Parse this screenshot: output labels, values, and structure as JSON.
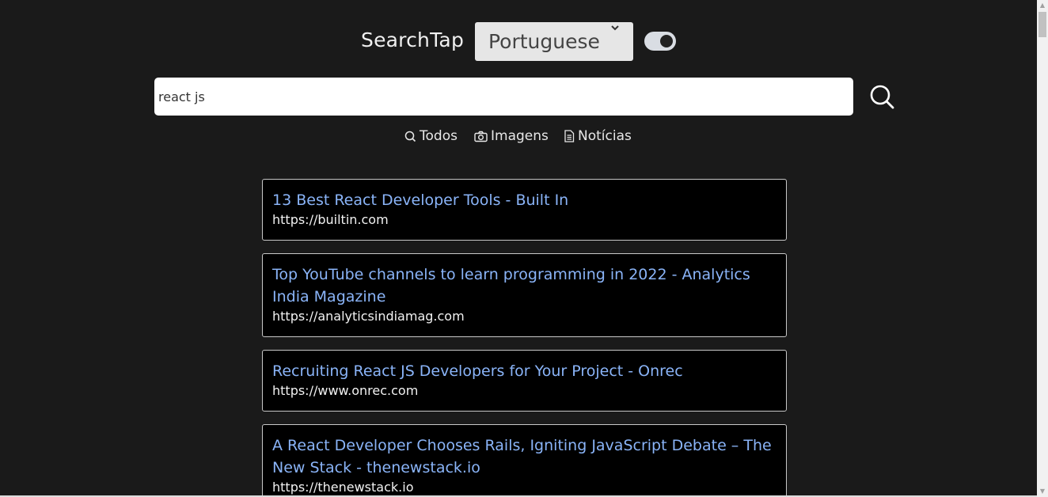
{
  "header": {
    "brand": "SearchTap",
    "language": {
      "selected": "Portuguese",
      "chevron": "ˇ"
    },
    "theme_toggle": {
      "state": "on",
      "icon": "toggle-switch"
    }
  },
  "search": {
    "query": "react js",
    "button_icon": "search-icon"
  },
  "tabs": [
    {
      "label": "Todos",
      "icon": "search-icon"
    },
    {
      "label": "Imagens",
      "icon": "camera-icon"
    },
    {
      "label": "Notícias",
      "icon": "document-icon"
    }
  ],
  "results": [
    {
      "title": "13 Best React Developer Tools - Built In",
      "url": "https://builtin.com"
    },
    {
      "title": "Top YouTube channels to learn programming in 2022 - Analytics India Magazine",
      "url": "https://analyticsindiamag.com"
    },
    {
      "title": "Recruiting React JS Developers for Your Project - Onrec",
      "url": "https://www.onrec.com"
    },
    {
      "title": "A React Developer Chooses Rails, Igniting JavaScript Debate – The New Stack - thenewstack.io",
      "url": "https://thenewstack.io"
    }
  ],
  "colors": {
    "background": "#1a1a1a",
    "result_background": "#000000",
    "link": "#8ab4f8",
    "select_background": "#e6e6e6"
  }
}
